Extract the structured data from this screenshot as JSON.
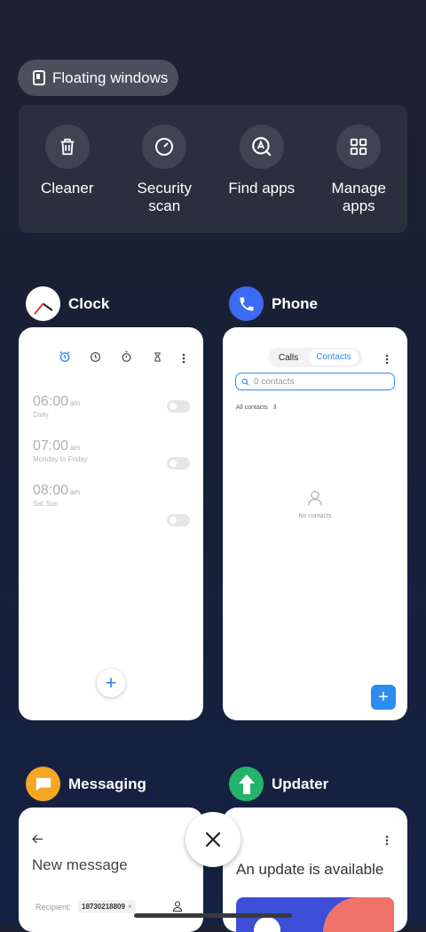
{
  "floating": {
    "label": "Floating windows"
  },
  "tools": [
    {
      "label": "Cleaner",
      "icon": "trash-icon"
    },
    {
      "label": "Security scan",
      "icon": "security-gauge-icon"
    },
    {
      "label": "Find apps",
      "icon": "find-apps-icon"
    },
    {
      "label": "Manage apps",
      "icon": "grid-icon"
    }
  ],
  "clock": {
    "name": "Clock",
    "alarms": [
      {
        "time": "06:00",
        "ampm": "am",
        "repeat": "Daily"
      },
      {
        "time": "07:00",
        "ampm": "am",
        "repeat": "Monday to Friday"
      },
      {
        "time": "08:00",
        "ampm": "am",
        "repeat": "Sat Sun"
      }
    ],
    "fab": "+"
  },
  "phone": {
    "name": "Phone",
    "tabs": [
      "Calls",
      "Contacts"
    ],
    "search_placeholder": "0 contacts",
    "filter": "All contacts",
    "empty": "No contacts",
    "fab": "+"
  },
  "messaging": {
    "name": "Messaging",
    "title": "New message",
    "recipient_label": "Recipient:",
    "recipient_chip": "18730218809",
    "chip_remove": "×"
  },
  "updater": {
    "name": "Updater",
    "title": "An update is available"
  },
  "colors": {
    "accent_blue": "#2d8cf0",
    "phone_icon": "#3d6af2",
    "messaging_icon": "#f5a623",
    "updater_icon": "#24b36b"
  }
}
